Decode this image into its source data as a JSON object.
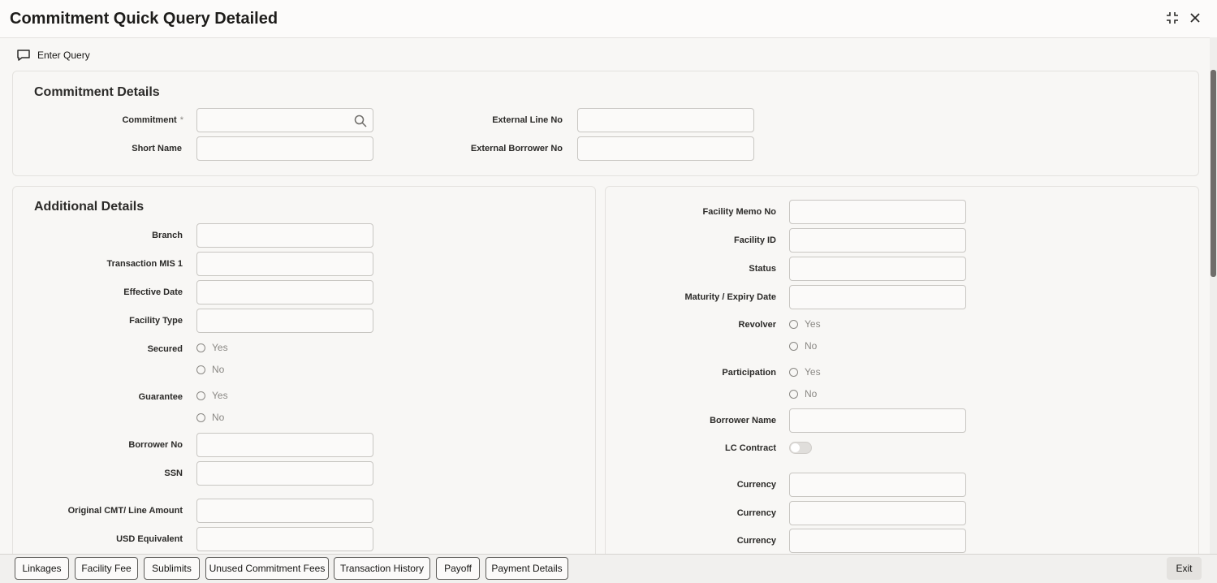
{
  "window": {
    "title": "Commitment Quick Query Detailed",
    "icons": [
      "collapse-icon",
      "close-icon"
    ]
  },
  "toolbar": {
    "enter_query_label": "Enter Query",
    "icon": "comment-icon"
  },
  "commitment_details": {
    "title": "Commitment Details",
    "commitment_label": "Commitment",
    "required_mark": "*",
    "commitment_value": "",
    "short_name_label": "Short Name",
    "short_name_value": "",
    "external_line_no_label": "External Line No",
    "external_line_no_value": "",
    "external_borrower_no_label": "External Borrower No",
    "external_borrower_no_value": ""
  },
  "additional_details": {
    "title": "Additional Details",
    "branch_label": "Branch",
    "transaction_mis1_label": "Transaction MIS 1",
    "effective_date_label": "Effective Date",
    "facility_type_label": "Facility Type",
    "secured_label": "Secured",
    "guarantee_label": "Guarantee",
    "borrower_no_label": "Borrower No",
    "ssn_label": "SSN",
    "original_cmt_label": "Original CMT/ Line Amount",
    "usd_equivalent_label": "USD Equivalent",
    "yes_label": "Yes",
    "no_label": "No"
  },
  "right_panel": {
    "facility_memo_no_label": "Facility Memo No",
    "facility_id_label": "Facility ID",
    "status_label": "Status",
    "maturity_expiry_date_label": "Maturity / Expiry Date",
    "revolver_label": "Revolver",
    "participation_label": "Participation",
    "borrower_name_label": "Borrower Name",
    "lc_contract_label": "LC Contract",
    "lc_contract_on": false,
    "currency_label_1": "Currency",
    "currency_label_2": "Currency",
    "currency_label_3": "Currency",
    "yes_label": "Yes",
    "no_label": "No"
  },
  "footer": {
    "buttons": [
      "Linkages",
      "Facility Fee",
      "Sublimits",
      "Unused Commitment Fees",
      "Transaction History",
      "Payoff",
      "Payment Details"
    ],
    "exit_label": "Exit"
  },
  "colors": {
    "background": "#f8f7f5",
    "border": "#e4e2df",
    "text": "#161513",
    "muted": "#8a8884"
  }
}
